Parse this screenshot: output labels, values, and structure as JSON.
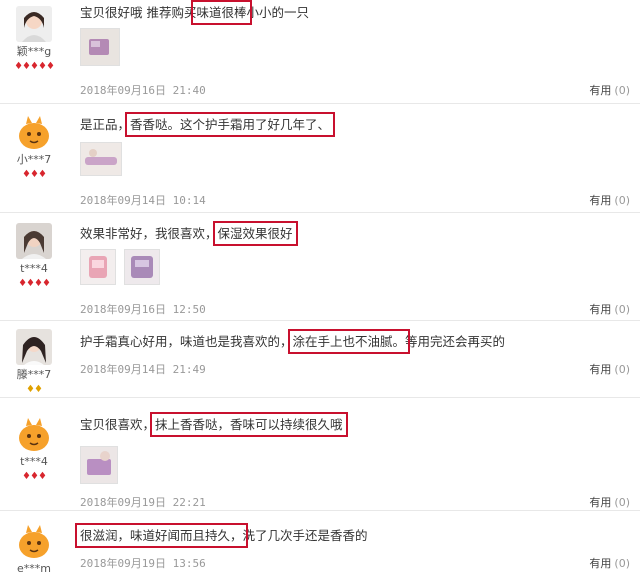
{
  "reviews": [
    {
      "user": "颖***g",
      "rank": "♦♦♦♦♦",
      "text_before": "宝贝很好哦 推荐购买",
      "text_highlight": "味道很棒",
      "text_after": "小小的一只",
      "date": "2018年09月16日 21:40",
      "useful_label": "有用",
      "useful_count": "(0)"
    },
    {
      "user": "小***7",
      "rank": "♦♦♦",
      "text_before": "是正品，",
      "text_highlight": "香香哒。这个护手霜用了好几年了、",
      "text_after": "",
      "date": "2018年09月14日 10:14",
      "useful_label": "有用",
      "useful_count": "(0)"
    },
    {
      "user": "t***4",
      "rank": "♦♦♦♦",
      "text_before": "效果非常好，我很喜欢，",
      "text_highlight": "保湿效果很好",
      "text_after": "",
      "date": "2018年09月16日 12:50",
      "useful_label": "有用",
      "useful_count": "(0)"
    },
    {
      "user": "滕***7",
      "rank": "♦♦",
      "text_before": "护手霜真心好用，味道也是我喜欢的，",
      "text_highlight": "涂在手上也不油腻。",
      "text_after": "等用完还会再买的",
      "date": "2018年09月14日 21:49",
      "useful_label": "有用",
      "useful_count": "(0)"
    },
    {
      "user": "t***4",
      "rank": "♦♦♦",
      "text_before": "宝贝很喜欢，",
      "text_highlight": "抹上香香哒，香味可以持续很久哦",
      "text_after": "",
      "date": "2018年09月19日 22:21",
      "useful_label": "有用",
      "useful_count": "(0)"
    },
    {
      "user": "e***m",
      "rank": "",
      "text_before": "",
      "text_highlight": "很滋润，味道好闻而且持久，",
      "text_after": "洗了几次手还是香香的",
      "date": "2018年09月19日 13:56",
      "useful_label": "有用",
      "useful_count": "(0)"
    }
  ],
  "colors": {
    "highlight_box": "#c8102e",
    "rank_red": "#d8262e",
    "rank_gold": "#e0a100"
  }
}
